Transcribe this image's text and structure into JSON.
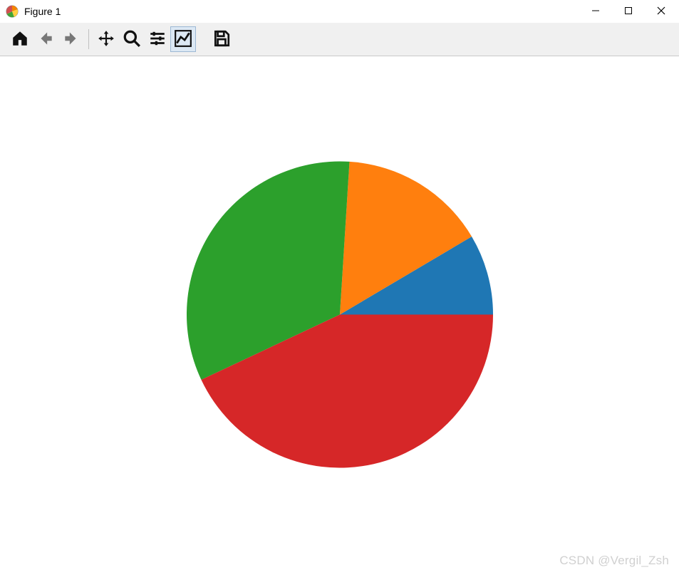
{
  "window": {
    "title": "Figure 1"
  },
  "toolbar": {
    "home_label": "Home",
    "back_label": "Back",
    "forward_label": "Forward",
    "pan_label": "Pan",
    "zoom_label": "Zoom",
    "subplots_label": "Configure subplots",
    "axes_label": "Edit axis",
    "save_label": "Save"
  },
  "watermark": "CSDN @Vergil_Zsh",
  "chart_data": {
    "type": "pie",
    "title": "",
    "slices": [
      {
        "label": "",
        "value": 8.5,
        "color": "#1f77b4"
      },
      {
        "label": "",
        "value": 15.5,
        "color": "#ff7f0e"
      },
      {
        "label": "",
        "value": 33.0,
        "color": "#2ca02c"
      },
      {
        "label": "",
        "value": 43.0,
        "color": "#d62728"
      }
    ],
    "start_angle_deg": 0,
    "direction": "ccw",
    "radius_px": 215
  }
}
